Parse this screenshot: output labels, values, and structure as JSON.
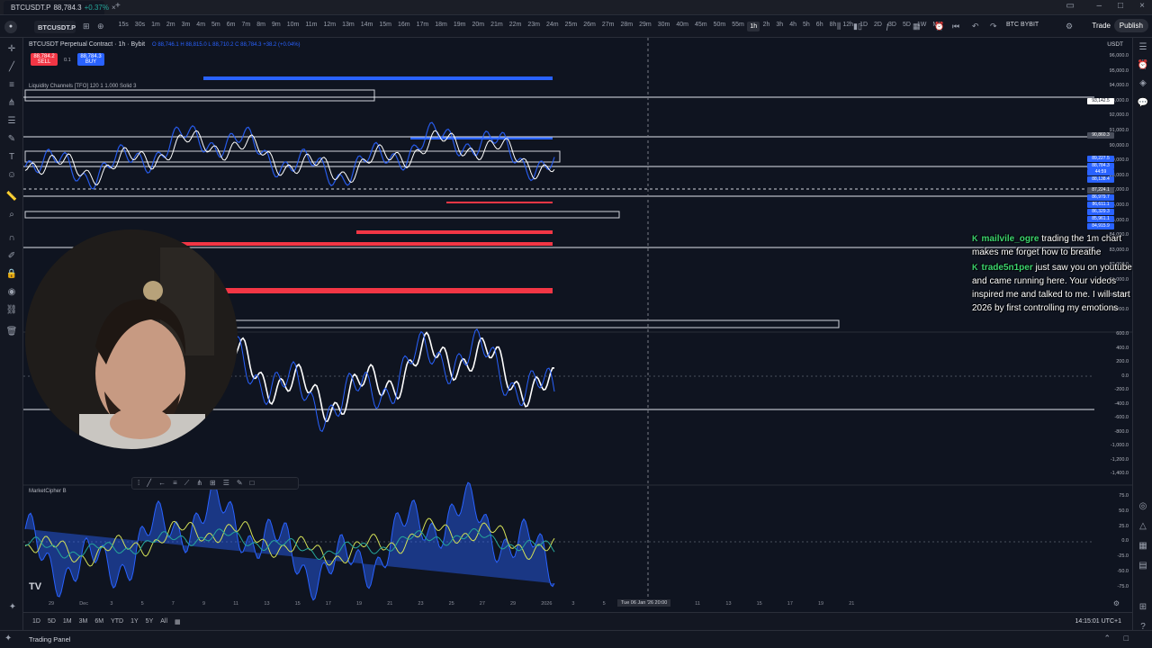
{
  "browser": {
    "tab_symbol": "BTCUSDT.P",
    "tab_price": "88,784.3",
    "tab_change": "+0.37%"
  },
  "toolbar": {
    "symbol": "BTCUSDT.P",
    "timeframes": [
      "15s",
      "30s",
      "1m",
      "2m",
      "3m",
      "4m",
      "5m",
      "6m",
      "7m",
      "8m",
      "9m",
      "10m",
      "11m",
      "12m",
      "13m",
      "14m",
      "15m",
      "16m",
      "17m",
      "18m",
      "19m",
      "20m",
      "21m",
      "22m",
      "23m",
      "24m",
      "25m",
      "26m",
      "27m",
      "28m",
      "29m",
      "30m",
      "40m",
      "45m",
      "50m",
      "55m",
      "1h",
      "2h",
      "3h",
      "4h",
      "5h",
      "6h",
      "8h",
      "12h",
      "1D",
      "2D",
      "3D",
      "5D",
      "1W",
      "M"
    ],
    "active_timeframe": "1h",
    "broker_label": "BTC BYBIT",
    "trade_label": "Trade",
    "publish_label": "Publish"
  },
  "legend": {
    "title": "BTCUSDT Perpetual Contract · 1h · Bybit",
    "ohlc": "O 88,746.1  H 88,815.0  L 88,710.2  C 88,784.3  +38.2 (+0.04%)",
    "sell_price": "88,784.2",
    "sell_label": "SELL",
    "spread": "0.1",
    "buy_price": "88,784.3",
    "buy_label": "BUY",
    "indicator1": "Liquidity Channels [TFO] 120 1 1.000 Solid 3",
    "indicator2": "MarketCipher B",
    "currency": "USDT"
  },
  "price_axis": [
    "96,000.0",
    "95,000.0",
    "94,000.0",
    "93,000.0",
    "92,000.0",
    "91,000.0",
    "90,000.0",
    "89,000.0",
    "88,000.0",
    "87,000.0",
    "86,000.0",
    "85,000.0",
    "84,000.0",
    "83,000.0",
    "82,000.0",
    "81,000.0",
    "80,000.0",
    "79,000.0"
  ],
  "osc_axis": [
    "600.0",
    "400.0",
    "200.0",
    "0.0",
    "-200.0",
    "-400.0",
    "-600.0",
    "-800.0",
    "-1,000.0",
    "-1,200.0",
    "-1,400.0"
  ],
  "mcb_axis": [
    "75.0",
    "50.0",
    "25.0",
    "0.0",
    "-25.0",
    "-50.0",
    "-75.0"
  ],
  "price_tags": [
    {
      "label": "93,142.5",
      "color": "#ffffff",
      "text": "#131722"
    },
    {
      "label": "90,860.3",
      "color": "#4a4f5c",
      "text": "#ffffff"
    },
    {
      "label": "89,227.5",
      "color": "#2962ff",
      "text": "#ffffff"
    },
    {
      "label": "88,784.3",
      "color": "#2962ff",
      "text": "#ffffff"
    },
    {
      "label": "44:59",
      "color": "#2962ff",
      "text": "#ffffff"
    },
    {
      "label": "88,138.4",
      "color": "#2962ff",
      "text": "#ffffff"
    },
    {
      "label": "87,224.1",
      "color": "#4a4f5c",
      "text": "#ffffff"
    },
    {
      "label": "86,979.7",
      "color": "#2962ff",
      "text": "#ffffff"
    },
    {
      "label": "86,611.1",
      "color": "#2962ff",
      "text": "#ffffff"
    },
    {
      "label": "86,329.3",
      "color": "#2962ff",
      "text": "#ffffff"
    },
    {
      "label": "85,961.1",
      "color": "#2962ff",
      "text": "#ffffff"
    },
    {
      "label": "84,915.9",
      "color": "#2962ff",
      "text": "#ffffff"
    }
  ],
  "x_axis": [
    "29",
    "Dec",
    "3",
    "5",
    "7",
    "9",
    "11",
    "13",
    "15",
    "17",
    "19",
    "21",
    "23",
    "25",
    "27",
    "29",
    "2026",
    "3",
    "5",
    "7",
    "9",
    "11",
    "13",
    "15",
    "17",
    "19",
    "21"
  ],
  "crosshair_label": "Tue 06 Jan '26   20:00",
  "bottom": {
    "ranges": [
      "1D",
      "5D",
      "1M",
      "3M",
      "6M",
      "YTD",
      "1Y",
      "5Y",
      "All"
    ],
    "clock": "14:15:01 UTC+1",
    "trading_panel": "Trading Panel"
  },
  "chat": [
    {
      "user": "mailvile_ogre",
      "message": "trading the 1m chart makes me forget how to breathe"
    },
    {
      "user": "trade5n1per",
      "message": "just saw you on youtube and came running here. Your videos inspired me and talked to me. I will start 2026 by first controlling my emotions"
    }
  ],
  "colors": {
    "background": "#0f1420",
    "price_line": "#ffffff",
    "wick": "#2962ff",
    "resistance": "#2962ff",
    "support": "#f23645",
    "chat_user": "#3cd46e"
  }
}
